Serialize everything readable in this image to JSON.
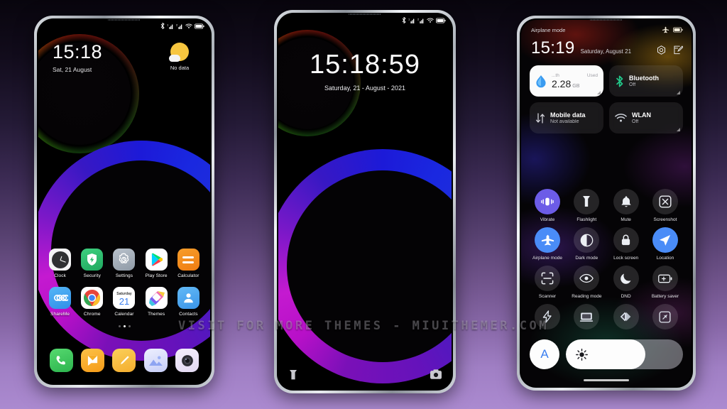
{
  "background": {
    "top_color": "#08050d",
    "bottom_color": "#ab8ad0"
  },
  "watermark": {
    "text": "VISIT FOR MORE THEMES - MIUITHEMER.COM"
  },
  "phone1": {
    "statusbar": {
      "icons": [
        "bluetooth-icon",
        "signal-1-icon",
        "signal-2-icon",
        "wifi-icon",
        "battery-icon"
      ]
    },
    "lockscreen": {
      "time": "15:18",
      "date": "Sat, 21 August"
    },
    "weather": {
      "icon": "sun-cloud-icon",
      "text": "No data"
    },
    "apps_row1": [
      {
        "label": "Clock",
        "icon": "clock-icon"
      },
      {
        "label": "Security",
        "icon": "security-shield-icon"
      },
      {
        "label": "Settings",
        "icon": "settings-gear-icon"
      },
      {
        "label": "Play Store",
        "icon": "play-store-icon"
      },
      {
        "label": "Calculator",
        "icon": "calculator-icon"
      }
    ],
    "apps_row2": [
      {
        "label": "ShareMe",
        "icon": "shareme-icon"
      },
      {
        "label": "Chrome",
        "icon": "chrome-icon"
      },
      {
        "label": "Calendar",
        "icon": "calendar-icon",
        "day_name": "Saturday",
        "day_num": "21"
      },
      {
        "label": "Themes",
        "icon": "themes-icon"
      },
      {
        "label": "Contacts",
        "icon": "contacts-icon"
      }
    ],
    "page_dots": {
      "count": 3,
      "active_index": 1
    },
    "dock": [
      {
        "label": "Phone",
        "icon": "phone-icon"
      },
      {
        "label": "Messages",
        "icon": "messages-icon"
      },
      {
        "label": "Notes",
        "icon": "notes-pencil-icon"
      },
      {
        "label": "Gallery",
        "icon": "gallery-icon"
      },
      {
        "label": "Camera",
        "icon": "camera-icon"
      }
    ]
  },
  "phone2": {
    "statusbar": {
      "icons": [
        "bluetooth-icon",
        "signal-1-icon",
        "signal-2-icon",
        "wifi-icon",
        "battery-icon"
      ]
    },
    "lockscreen": {
      "time": "15:18:59",
      "date": "Saturday, 21 - August - 2021"
    },
    "shortcuts": [
      {
        "name": "flashlight-shortcut",
        "icon": "flashlight-icon"
      },
      {
        "name": "camera-shortcut",
        "icon": "camera-icon"
      }
    ]
  },
  "phone3": {
    "status": {
      "airplane_text": "Airplane mode",
      "icons": [
        "airplane-icon",
        "battery-icon"
      ]
    },
    "header": {
      "time": "15:19",
      "date": "Saturday, August 21",
      "icons": [
        "settings-gear-icon",
        "edit-icon"
      ]
    },
    "big_tiles": [
      {
        "name": "data-usage-tile",
        "style": "light",
        "icon": "water-drop-icon",
        "top_left": "...th",
        "top_right": "Used",
        "value": "2.28",
        "unit": "GB"
      },
      {
        "name": "bluetooth-tile",
        "style": "dark",
        "icon": "bluetooth-icon",
        "title": "Bluetooth",
        "sub": "Off"
      },
      {
        "name": "mobile-data-tile",
        "style": "dark",
        "icon": "mobile-data-icon",
        "title": "Mobile data",
        "sub": "Not available"
      },
      {
        "name": "wlan-tile",
        "style": "dark",
        "icon": "wifi-icon",
        "title": "WLAN",
        "sub": "Off"
      }
    ],
    "tiles": [
      [
        {
          "label": "Vibrate",
          "icon": "vibrate-icon",
          "state": "vibrate"
        },
        {
          "label": "Flashlight",
          "icon": "flashlight-icon",
          "state": "off"
        },
        {
          "label": "Mute",
          "icon": "bell-icon",
          "state": "off"
        },
        {
          "label": "Screenshot",
          "icon": "screenshot-icon",
          "state": "off"
        }
      ],
      [
        {
          "label": "Airplane mode",
          "icon": "airplane-icon",
          "state": "on"
        },
        {
          "label": "Dark mode",
          "icon": "dark-mode-icon",
          "state": "off"
        },
        {
          "label": "Lock screen",
          "icon": "lock-icon",
          "state": "off"
        },
        {
          "label": "Location",
          "icon": "location-icon",
          "state": "on"
        }
      ],
      [
        {
          "label": "Scanner",
          "icon": "scanner-icon",
          "state": "off"
        },
        {
          "label": "Reading mode",
          "icon": "eye-icon",
          "state": "off"
        },
        {
          "label": "DND",
          "icon": "moon-icon",
          "state": "off"
        },
        {
          "label": "Battery saver",
          "icon": "battery-saver-icon",
          "state": "off"
        }
      ],
      [
        {
          "label": "",
          "icon": "quick-ball-icon",
          "state": "off"
        },
        {
          "label": "",
          "icon": "cast-icon",
          "state": "off"
        },
        {
          "label": "",
          "icon": "sync-icon",
          "state": "off"
        },
        {
          "label": "",
          "icon": "expand-icon",
          "state": "off"
        }
      ]
    ],
    "brightness": {
      "auto_label": "A",
      "icon": "brightness-icon",
      "value_percent": 68
    }
  }
}
